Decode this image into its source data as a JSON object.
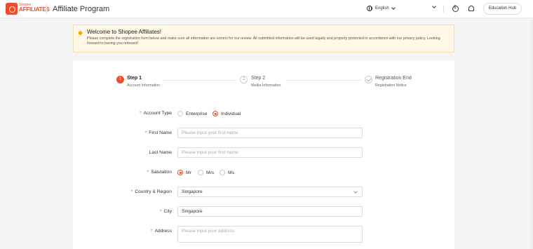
{
  "header": {
    "logo_line1": "Shopee",
    "logo_line2": "AFFILIATES",
    "app_title": "Affiliate Program",
    "language": "English",
    "education_hub_label": "Education Hub"
  },
  "welcome": {
    "title": "Welcome to Shopee Affiliates!",
    "message": "Please complete the registration form below and make sure all information are correct for our review. All submitted information will be used legally and properly protected in accordance with our privacy policy. Looking forward to having you onboard!"
  },
  "steps": [
    {
      "number": "1",
      "title": "Step 1",
      "subtitle": "Account Information",
      "state": "active"
    },
    {
      "number": "2",
      "title": "Step 2",
      "subtitle": "Media Information",
      "state": "pending"
    },
    {
      "number": "",
      "title": "Registration End",
      "subtitle": "Registration Notice",
      "state": "pending"
    }
  ],
  "form": {
    "account_type": {
      "label": "Account Type",
      "options": [
        "Enterprise",
        "Individual"
      ],
      "selected": "Individual"
    },
    "first_name": {
      "label": "First Name",
      "value": "",
      "placeholder": "Please input your first name"
    },
    "last_name": {
      "label": "Last Name",
      "value": "",
      "placeholder": "Please input your first name"
    },
    "salutation": {
      "label": "Salutation",
      "options": [
        "Mr",
        "Mrs",
        "Ms"
      ],
      "selected": "Mr"
    },
    "country": {
      "label": "Country & Region",
      "value": "Singapore"
    },
    "city": {
      "label": "City",
      "value": "Singapore"
    },
    "address": {
      "label": "Address",
      "value": "",
      "placeholder": "Please input your address"
    },
    "required_mark": "*"
  },
  "colors": {
    "accent": "#ee4d2d",
    "banner_bg": "#fff8e6",
    "page_bg": "#f5f5f5"
  },
  "icons": [
    "shopee-logo-icon",
    "globe-icon",
    "chevron-down-icon",
    "billing-icon",
    "bell-icon",
    "speaker-icon",
    "check-icon"
  ]
}
